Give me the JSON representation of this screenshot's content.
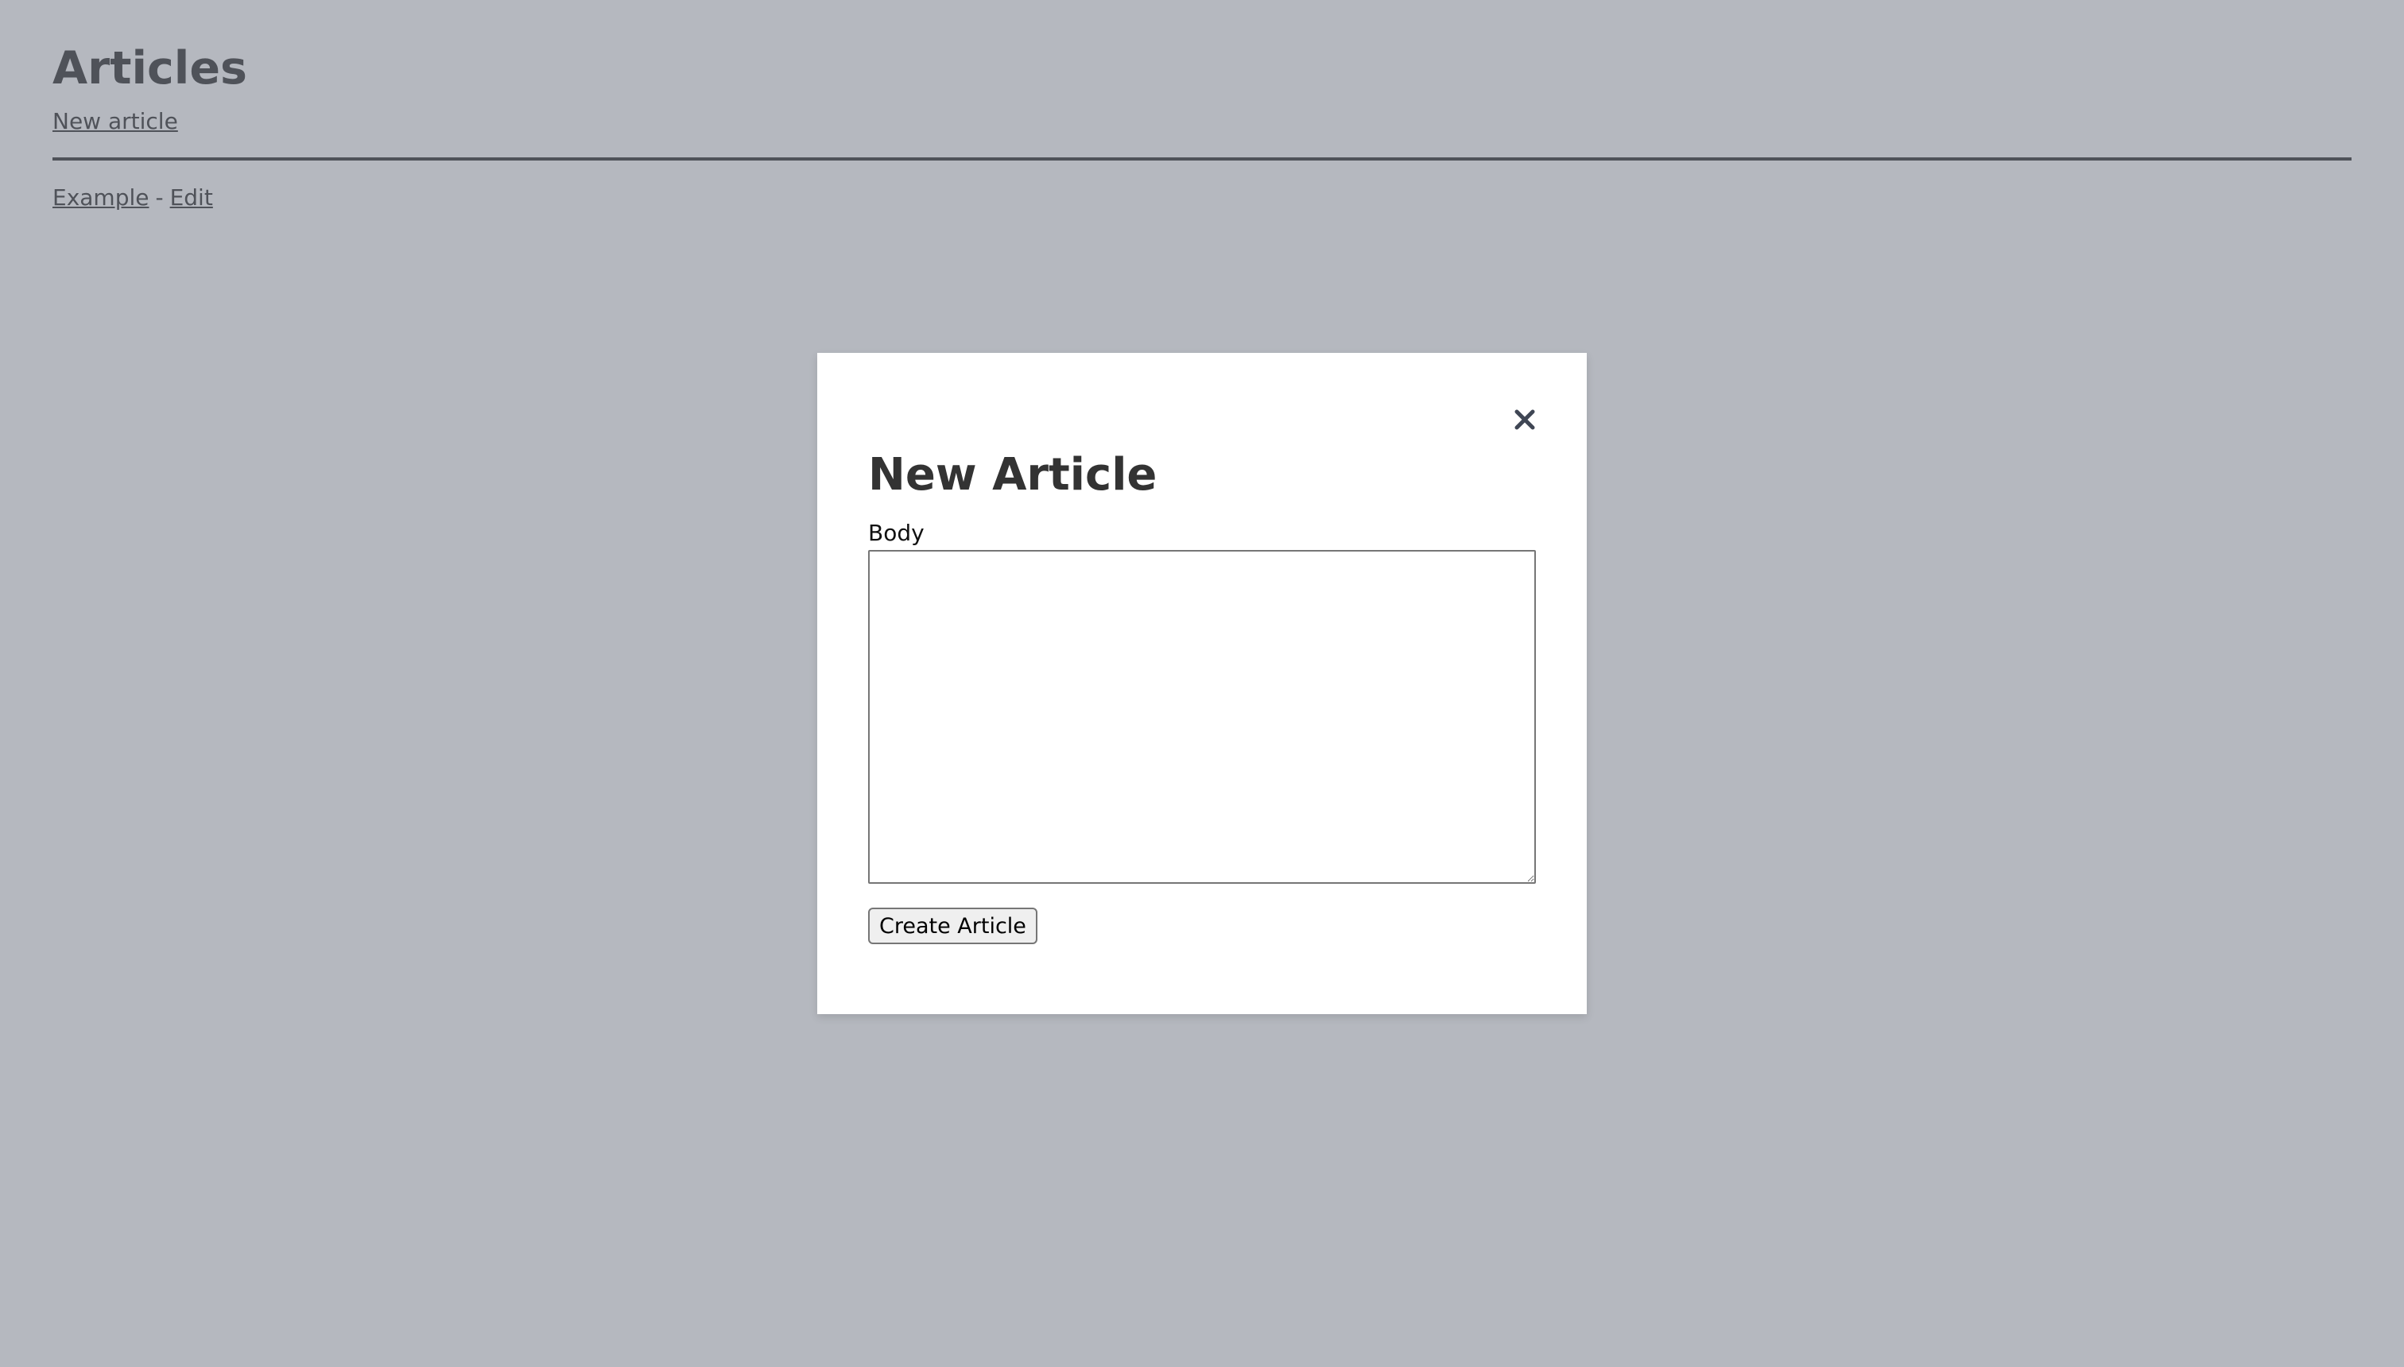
{
  "page": {
    "title": "Articles",
    "new_article_link": "New article",
    "articles": [
      {
        "title": "Example",
        "separator": "-",
        "edit_label": "Edit"
      }
    ]
  },
  "modal": {
    "close_icon": "close-icon",
    "title": "New Article",
    "body_label": "Body",
    "body_value": "",
    "submit_label": "Create Article"
  },
  "colors": {
    "text": "#333333",
    "overlay": "#b3b7bf",
    "modal_bg": "#ffffff"
  }
}
